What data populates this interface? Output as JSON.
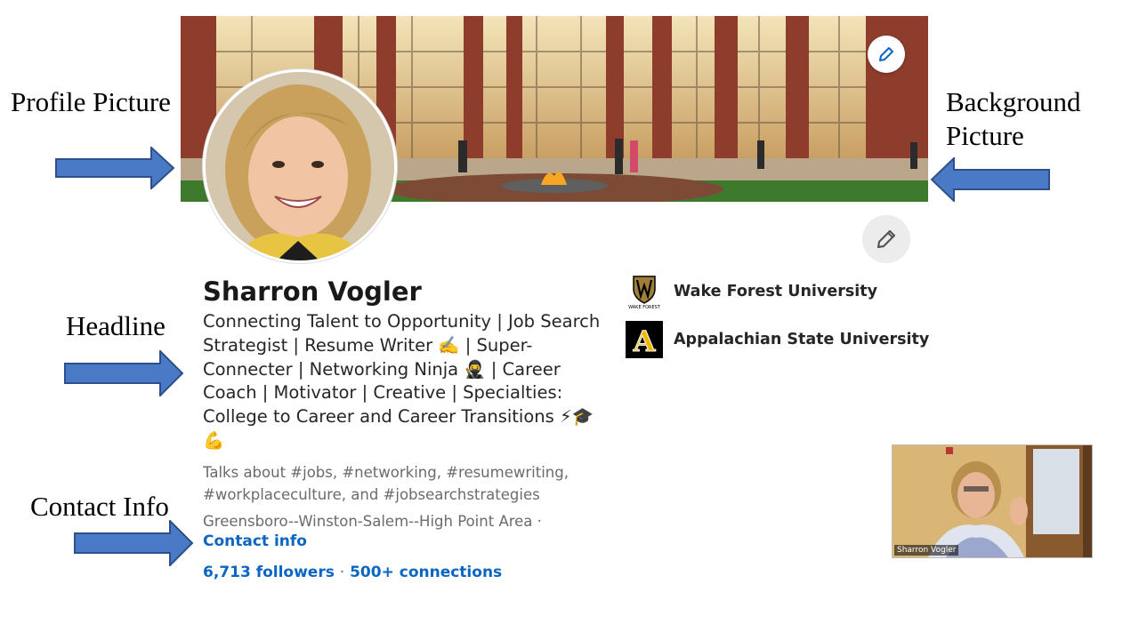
{
  "annotations": {
    "profile_picture": "Profile Picture",
    "background_picture_line1": "Background",
    "background_picture_line2": "Picture",
    "headline": "Headline",
    "contact_info": "Contact Info"
  },
  "profile": {
    "name": "Sharron Vogler",
    "headline": "Connecting Talent to Opportunity | Job Search Strategist | Resume Writer ✍️ | Super-Connecter | Networking Ninja 🥷 | Career Coach | Motivator | Creative | Specialties: College to Career and Career Transitions ⚡🎓 💪",
    "talks_about": "Talks about #jobs, #networking, #resumewriting, #workplaceculture, and #jobsearchstrategies",
    "location": "Greensboro--Winston-Salem--High Point Area ·",
    "contact_link": "Contact info",
    "followers": "6,713 followers",
    "separator": "·",
    "connections": "500+ connections"
  },
  "education": [
    {
      "name": "Wake Forest University",
      "logo_text": "WAKE FOREST",
      "icon": "wake-forest-logo"
    },
    {
      "name": "Appalachian State University",
      "logo_text": "A",
      "icon": "app-state-logo"
    }
  ],
  "video": {
    "participant_name": "Sharron Vogler"
  },
  "colors": {
    "arrow_fill": "#4a7ac6",
    "arrow_stroke": "#2d4f8a",
    "link_blue": "#0a66c2"
  },
  "icons": {
    "banner_edit": "pencil-icon",
    "profile_edit": "pencil-icon"
  }
}
